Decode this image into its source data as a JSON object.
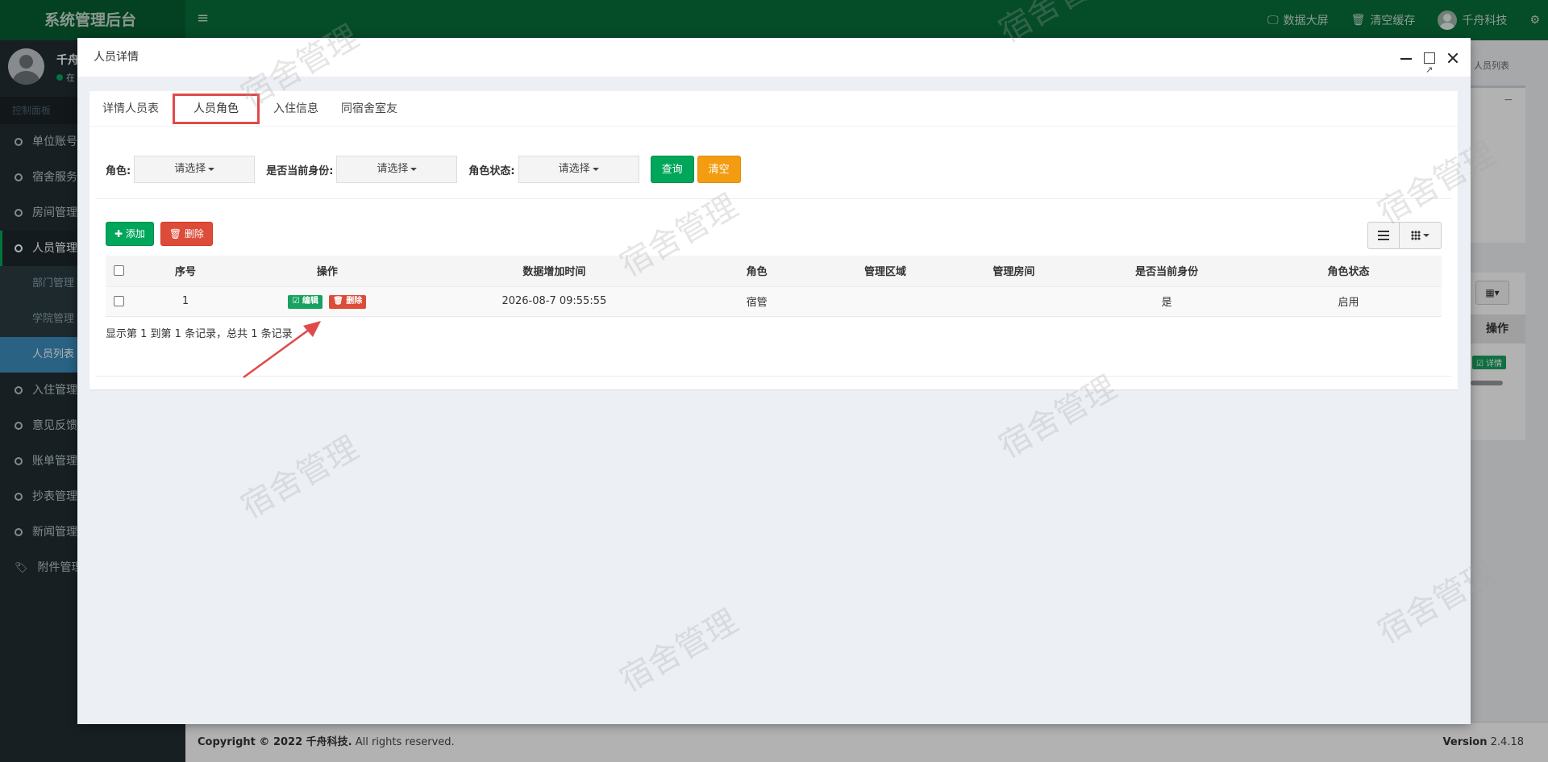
{
  "header": {
    "brand": "系统管理后台",
    "menu_toggle": "≡",
    "actions": [
      {
        "icon": "monitor-icon",
        "label": "数据大屏"
      },
      {
        "icon": "trash-icon",
        "label": "清空缓存"
      },
      {
        "icon": "avatar",
        "label": "千舟科技"
      }
    ],
    "settings_icon": "gears-icon"
  },
  "sidebar": {
    "user_name": "千舟",
    "user_status": "在",
    "section": "控制面板",
    "items": [
      {
        "label": "单位账号",
        "active": false
      },
      {
        "label": "宿舍服务",
        "active": false
      },
      {
        "label": "房间管理",
        "active": false
      },
      {
        "label": "人员管理",
        "active": true
      }
    ],
    "sub_items": [
      {
        "label": "部门管理",
        "active": false
      },
      {
        "label": "学院管理",
        "active": false
      },
      {
        "label": "人员列表",
        "active": true
      }
    ],
    "items_after": [
      {
        "label": "入住管理"
      },
      {
        "label": "意见反馈"
      },
      {
        "label": "账单管理"
      },
      {
        "label": "抄表管理"
      },
      {
        "label": "新闻管理"
      },
      {
        "label": "附件管理"
      }
    ]
  },
  "background": {
    "breadcrumb": "人员列表",
    "minus": "−",
    "operation_header": "操作",
    "detail_btn": "☑ 详情"
  },
  "footer": {
    "copyright_prefix": "Copyright © 2022 千舟科技.",
    "copyright_suffix": " All rights reserved.",
    "version_label": "Version",
    "version": "2.4.18"
  },
  "modal": {
    "title": "人员详情",
    "tabs": [
      {
        "label": "详情人员表",
        "active": false
      },
      {
        "label": "人员角色",
        "active": true
      },
      {
        "label": "入住信息",
        "active": false
      },
      {
        "label": "同宿舍室友",
        "active": false
      }
    ],
    "filters": [
      {
        "label": "角色:",
        "value": "请选择"
      },
      {
        "label": "是否当前身份:",
        "value": "请选择"
      },
      {
        "label": "角色状态:",
        "value": "请选择"
      }
    ],
    "query_btn": "查询",
    "clear_btn": "清空",
    "add_btn": "✚ 添加",
    "delete_btn": "🗑 删除",
    "table": {
      "columns": [
        "序号",
        "操作",
        "数据增加时间",
        "角色",
        "管理区域",
        "管理房间",
        "是否当前身份",
        "角色状态"
      ],
      "rows": [
        {
          "seq": "1",
          "edit": "☑ 编辑",
          "del": "🗑 删除",
          "time": "2026-08-7 09:55:55",
          "role": "宿管",
          "area": "",
          "room": "",
          "current": "是",
          "status": "启用"
        }
      ]
    },
    "summary": "显示第 1 到第 1 条记录，总共 1 条记录"
  },
  "watermark": "宿舍管理",
  "colors": {
    "primary": "#086e3a",
    "green": "#00a65a",
    "red": "#dd4b39",
    "orange": "#f39c12",
    "highlight_box": "#e04a4a",
    "arrow": "#e04a4a"
  }
}
